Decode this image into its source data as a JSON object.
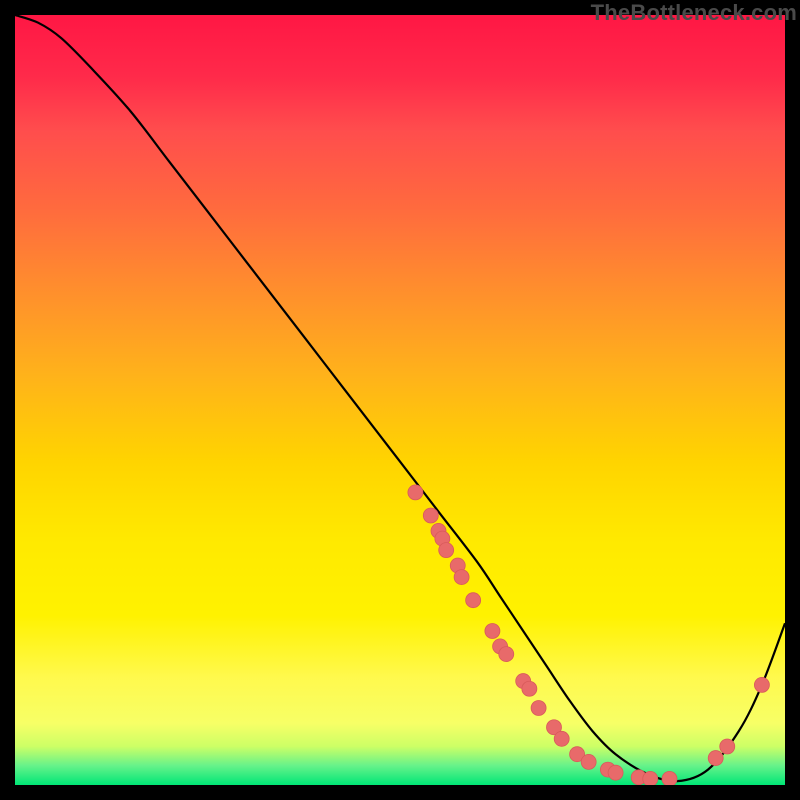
{
  "watermark": "TheBottleneck.com",
  "chart_data": {
    "type": "line",
    "title": "",
    "xlabel": "",
    "ylabel": "",
    "xlim": [
      0,
      100
    ],
    "ylim": [
      0,
      100
    ],
    "curve": {
      "x": [
        0,
        3,
        6,
        10,
        15,
        20,
        25,
        30,
        35,
        40,
        45,
        50,
        55,
        60,
        63,
        66,
        69,
        72,
        75,
        78,
        82,
        86,
        90,
        94,
        97,
        100
      ],
      "y": [
        100,
        99,
        97,
        93,
        87.5,
        81,
        74.5,
        68,
        61.5,
        55,
        48.5,
        42,
        35.5,
        29,
        24.5,
        20,
        15.5,
        11,
        7,
        4,
        1.5,
        0.5,
        2,
        7,
        13,
        21
      ]
    },
    "points": [
      {
        "x": 52,
        "y": 38
      },
      {
        "x": 54,
        "y": 35
      },
      {
        "x": 55,
        "y": 33
      },
      {
        "x": 55.5,
        "y": 32
      },
      {
        "x": 56,
        "y": 30.5
      },
      {
        "x": 57.5,
        "y": 28.5
      },
      {
        "x": 58,
        "y": 27
      },
      {
        "x": 59.5,
        "y": 24
      },
      {
        "x": 62,
        "y": 20
      },
      {
        "x": 63,
        "y": 18
      },
      {
        "x": 63.8,
        "y": 17
      },
      {
        "x": 66,
        "y": 13.5
      },
      {
        "x": 66.8,
        "y": 12.5
      },
      {
        "x": 68,
        "y": 10
      },
      {
        "x": 70,
        "y": 7.5
      },
      {
        "x": 71,
        "y": 6
      },
      {
        "x": 73,
        "y": 4
      },
      {
        "x": 74.5,
        "y": 3
      },
      {
        "x": 77,
        "y": 2
      },
      {
        "x": 78,
        "y": 1.6
      },
      {
        "x": 81,
        "y": 1
      },
      {
        "x": 82.5,
        "y": 0.8
      },
      {
        "x": 85,
        "y": 0.8
      },
      {
        "x": 91,
        "y": 3.5
      },
      {
        "x": 92.5,
        "y": 5
      },
      {
        "x": 97,
        "y": 13
      }
    ]
  }
}
